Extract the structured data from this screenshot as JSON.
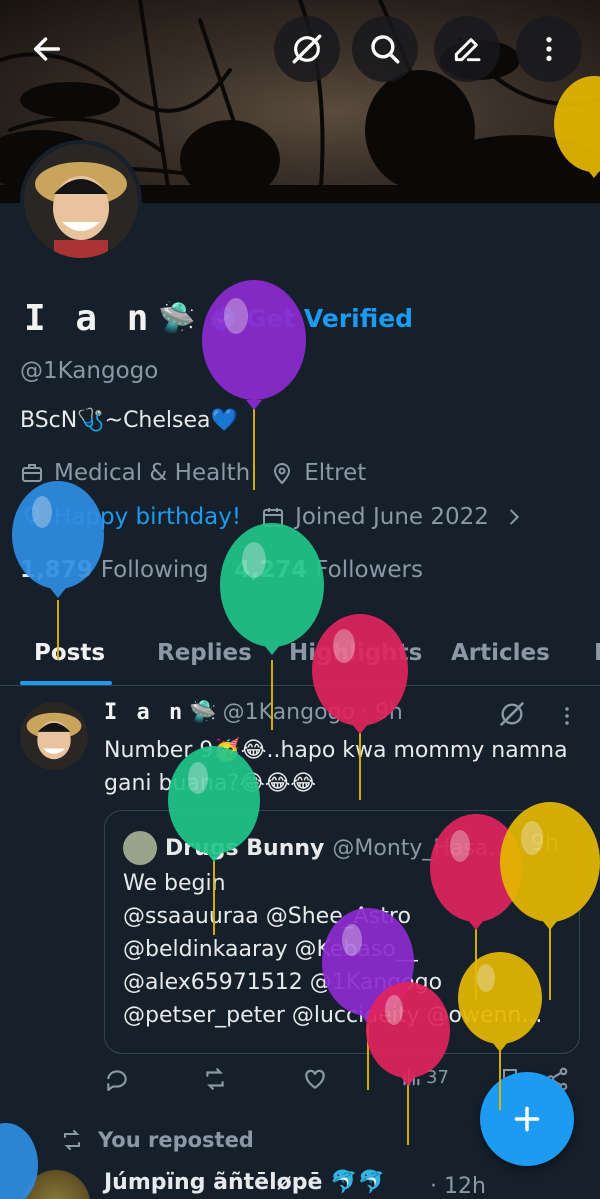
{
  "profile": {
    "display_name": "I a n",
    "name_emoji": "🛸",
    "get_verified_label": "Get Verified",
    "handle": "@1Kangogo",
    "bio_text_1": "BScN",
    "bio_emoji_1": "🩺",
    "bio_text_2": "~Chelsea",
    "bio_emoji_2": "💙",
    "category": "Medical & Health",
    "location": "Eltret",
    "birthday": "Happy birthday!",
    "joined": "Joined June 2022",
    "following_count": "1,879",
    "following_label": "Following",
    "followers_count": "4,274",
    "followers_label": "Followers"
  },
  "tabs": [
    "Posts",
    "Replies",
    "Highlights",
    "Articles",
    "M"
  ],
  "post": {
    "author_name": "I a n",
    "author_emoji": "🛸",
    "author_handle": "@1Kangogo",
    "time": "· 9h",
    "text": "Number 9🥳😂..hapo kwa mommy namna gani buana?😂😂😂",
    "quote": {
      "author_name": "Drugs Bunny",
      "author_handle": "@Monty_Hasa...",
      "time": "9h",
      "lines": [
        "We begin",
        "@ssaauuraa @Shee_Astro",
        "@beldinkaaray @Kebaso__",
        "@alex65971512 @1Kangogo",
        "@petser_peter @luccideity @owenn..."
      ]
    },
    "views_count": "37"
  },
  "repost_label": "You reposted",
  "next_post": {
    "author_name": "Júmpïng ãñtēløpē 🐬🐬",
    "time": "· 12h"
  },
  "colors": {
    "background": "#15202b",
    "accent": "#1d9bf0",
    "muted": "#8b98a5"
  },
  "icons": [
    "back-arrow-icon",
    "grok-icon",
    "search-icon",
    "edit-icon",
    "more-vertical-icon",
    "verified-badge-icon",
    "briefcase-icon",
    "location-icon",
    "balloon-icon",
    "calendar-icon",
    "chevron-right-icon",
    "reply-icon",
    "repost-icon",
    "like-icon",
    "views-icon",
    "bookmark-icon",
    "share-icon",
    "plus-icon"
  ]
}
